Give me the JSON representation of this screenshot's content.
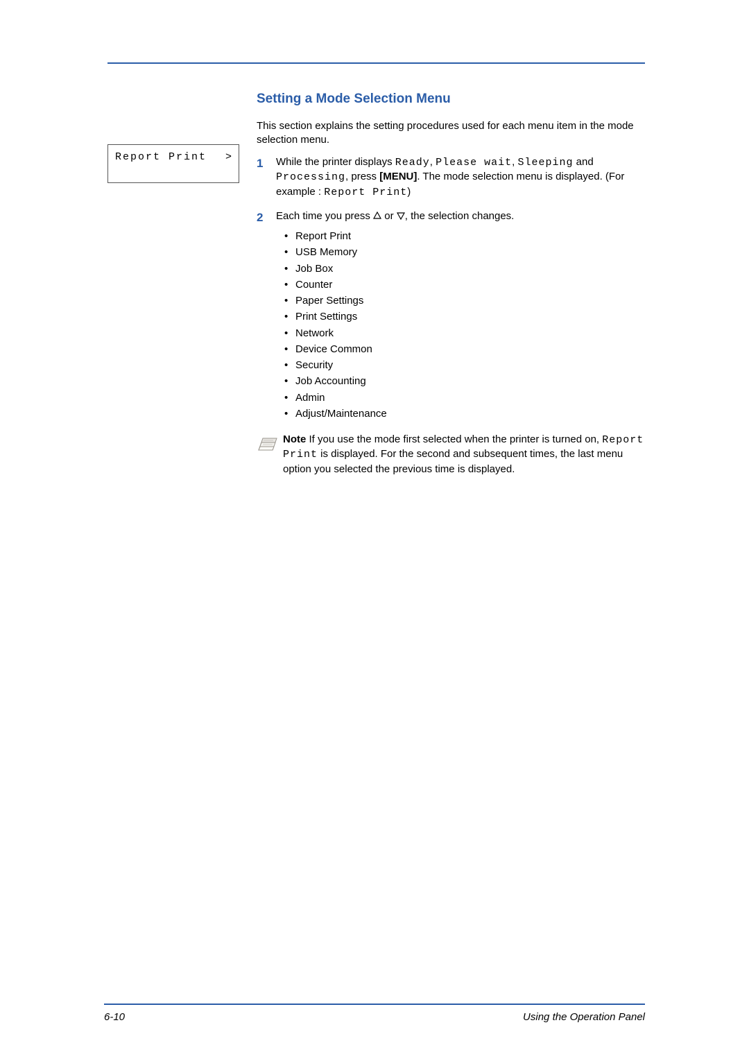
{
  "heading": "Setting a Mode Selection Menu",
  "intro": "This section explains the setting procedures used for each menu item in the mode selection menu.",
  "lcd": {
    "line1_left": "Report Print",
    "line1_right": ">"
  },
  "step1": {
    "num": "1",
    "t1": "While the printer displays ",
    "mono1": "Ready",
    "sep1": ", ",
    "mono2": "Please wait",
    "sep2": ", ",
    "mono3": "Sleeping",
    "t2": " and ",
    "mono4": "Processing",
    "t3": ", press ",
    "bold1": "[MENU]",
    "t4": ". The mode selection menu is displayed. (For example : ",
    "mono5": "Report Print",
    "t5": ")"
  },
  "step2": {
    "num": "2",
    "t1": "Each time you press ",
    "t2": " or ",
    "t3": ", the selection changes.",
    "bullets": [
      "Report Print",
      "USB Memory",
      "Job Box",
      "Counter",
      "Paper Settings",
      "Print Settings",
      "Network",
      "Device Common",
      "Security",
      "Job Accounting",
      "Admin",
      "Adjust/Maintenance"
    ]
  },
  "note": {
    "label": "Note",
    "t1": "  If you use the mode first selected when the printer is turned on, ",
    "mono1": "Report Print",
    "t2": " is displayed. For the second and subsequent times, the last menu option you selected the previous time is displayed."
  },
  "footer": {
    "left": "6-10",
    "right": "Using the Operation Panel"
  }
}
